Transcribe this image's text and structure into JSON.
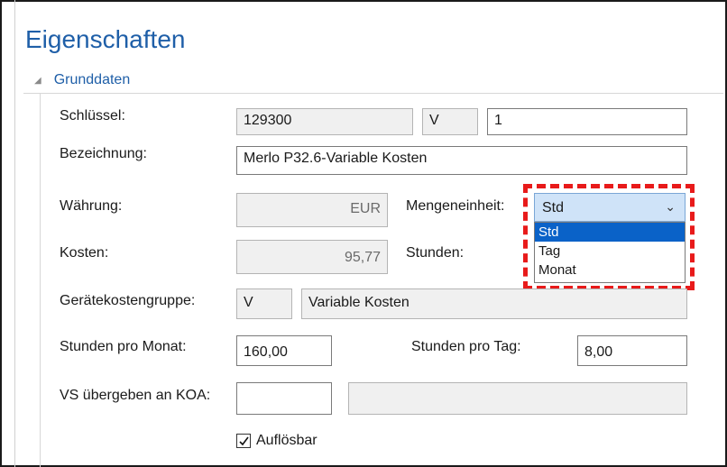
{
  "panel": {
    "title": "Eigenschaften"
  },
  "section": {
    "label": "Grunddaten",
    "expander_icon": "triangle-down-icon"
  },
  "fields": {
    "schluessel": {
      "label": "Schlüssel:",
      "value1": "129300",
      "value2": "V",
      "value3": "1"
    },
    "bezeichnung": {
      "label": "Bezeichnung:",
      "value": "Merlo P32.6-Variable Kosten"
    },
    "waehrung": {
      "label": "Währung:",
      "value": "EUR"
    },
    "mengeneinheit": {
      "label": "Mengeneinheit:",
      "selected": "Std",
      "options": [
        "Std",
        "Tag",
        "Monat"
      ]
    },
    "kosten": {
      "label": "Kosten:",
      "value": "95,77"
    },
    "stunden": {
      "label": "Stunden:"
    },
    "geraetekostengruppe": {
      "label": "Gerätekostengruppe:",
      "code": "V",
      "name": "Variable Kosten"
    },
    "stunden_pro_monat": {
      "label": "Stunden pro Monat:",
      "value": "160,00"
    },
    "stunden_pro_tag": {
      "label": "Stunden pro Tag:",
      "value": "8,00"
    },
    "vs_uebergeben": {
      "label": "VS übergeben an KOA:",
      "value1": "",
      "value2": ""
    },
    "aufloesbar": {
      "label": "Auflösbar",
      "checked": true
    }
  },
  "colors": {
    "accent": "#1f5fa8",
    "highlight": "#e81a1a",
    "selection": "#0a62c8"
  }
}
